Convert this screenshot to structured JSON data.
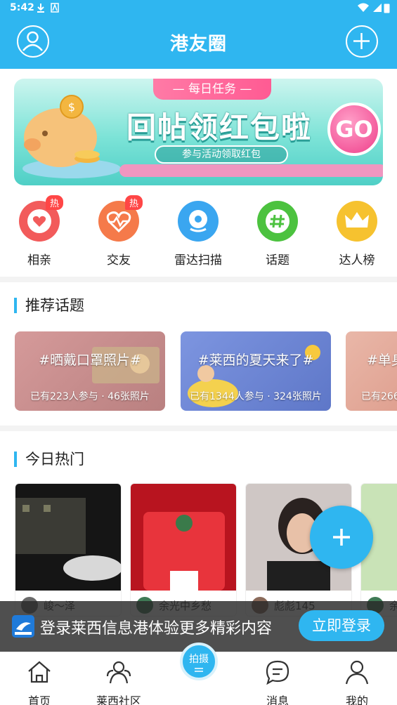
{
  "status_bar": {
    "time": "5:42"
  },
  "header": {
    "title": "港友圈"
  },
  "banner": {
    "tag": "— 每日任务 —",
    "headline": "回帖领红包啦",
    "subline": "参与活动领取红包",
    "go_label": "GO"
  },
  "quick_nav": [
    {
      "label": "相亲",
      "badge": "热",
      "color": "#f25b5b"
    },
    {
      "label": "交友",
      "badge": "热",
      "color": "#f57a4a"
    },
    {
      "label": "雷达扫描",
      "badge": "",
      "color": "#3aa6f0"
    },
    {
      "label": "话题",
      "badge": "",
      "color": "#4cc23f"
    },
    {
      "label": "达人榜",
      "badge": "",
      "color": "#f6c22f"
    }
  ],
  "recommended": {
    "section_title": "推荐话题",
    "topics": [
      {
        "title": "#晒戴口罩照片#",
        "meta": "已有223人参与 · 46张照片"
      },
      {
        "title": "#莱西的夏天来了#",
        "meta": "已有1344人参与 · 324张照片"
      },
      {
        "title": "#单身",
        "meta": "已有266"
      }
    ]
  },
  "hot_today": {
    "section_title": "今日热门",
    "posts": [
      {
        "user": "峻～泽"
      },
      {
        "user": "余光中乡愁"
      },
      {
        "user": "彪彪145"
      },
      {
        "user": "余"
      }
    ]
  },
  "login_bar": {
    "text": "登录莱西信息港体验更多精彩内容",
    "button": "立即登录"
  },
  "bottom_nav": {
    "items": [
      {
        "label": "首页"
      },
      {
        "label": "莱西社区"
      },
      {
        "label": "消息"
      },
      {
        "label": "我的"
      }
    ],
    "center_button": "拍摄"
  }
}
